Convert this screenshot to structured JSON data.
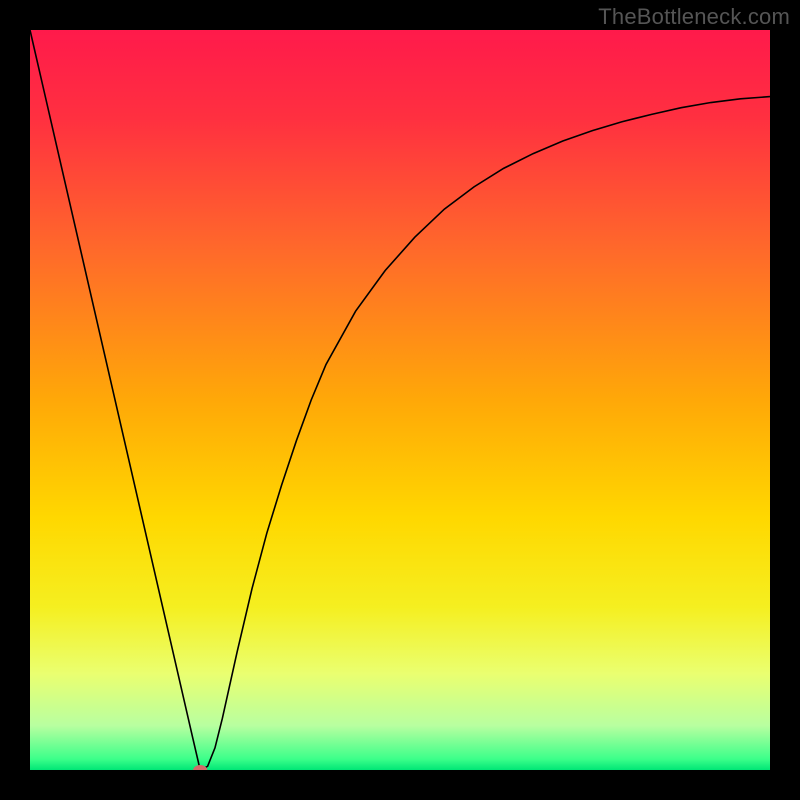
{
  "watermark": "TheBottleneck.com",
  "chart_data": {
    "type": "line",
    "title": "",
    "xlabel": "",
    "ylabel": "",
    "xlim": [
      0,
      100
    ],
    "ylim": [
      0,
      100
    ],
    "grid": false,
    "legend": false,
    "background": {
      "type": "vertical-gradient",
      "stops": [
        {
          "pos": 0.0,
          "color": "#ff1a4b"
        },
        {
          "pos": 0.12,
          "color": "#ff3040"
        },
        {
          "pos": 0.3,
          "color": "#ff6a2a"
        },
        {
          "pos": 0.5,
          "color": "#ffa808"
        },
        {
          "pos": 0.66,
          "color": "#ffd800"
        },
        {
          "pos": 0.78,
          "color": "#f5ef20"
        },
        {
          "pos": 0.87,
          "color": "#eaff70"
        },
        {
          "pos": 0.94,
          "color": "#b8ffa0"
        },
        {
          "pos": 0.985,
          "color": "#3dff8a"
        },
        {
          "pos": 1.0,
          "color": "#00e676"
        }
      ]
    },
    "series": [
      {
        "name": "bottleneck-curve",
        "color": "#000000",
        "width": 1.6,
        "x": [
          0.0,
          2.0,
          4.0,
          6.0,
          8.0,
          10.0,
          12.0,
          14.0,
          16.0,
          18.0,
          20.0,
          22.0,
          23.0,
          24.0,
          25.0,
          26.0,
          28.0,
          30.0,
          32.0,
          34.0,
          36.0,
          38.0,
          40.0,
          44.0,
          48.0,
          52.0,
          56.0,
          60.0,
          64.0,
          68.0,
          72.0,
          76.0,
          80.0,
          84.0,
          88.0,
          92.0,
          96.0,
          100.0
        ],
        "y": [
          100.0,
          91.3,
          82.6,
          73.9,
          65.2,
          56.5,
          47.8,
          39.1,
          30.4,
          21.7,
          13.0,
          4.3,
          0.0,
          0.5,
          3.0,
          7.0,
          16.0,
          24.5,
          32.0,
          38.5,
          44.5,
          50.0,
          54.8,
          62.0,
          67.5,
          72.0,
          75.8,
          78.8,
          81.3,
          83.3,
          85.0,
          86.4,
          87.6,
          88.6,
          89.5,
          90.2,
          90.7,
          91.0
        ]
      }
    ],
    "marker": {
      "name": "optimal-point",
      "x": 23.0,
      "y": 0.0,
      "color": "#d46a6a",
      "rx": 7,
      "ry": 5
    }
  }
}
